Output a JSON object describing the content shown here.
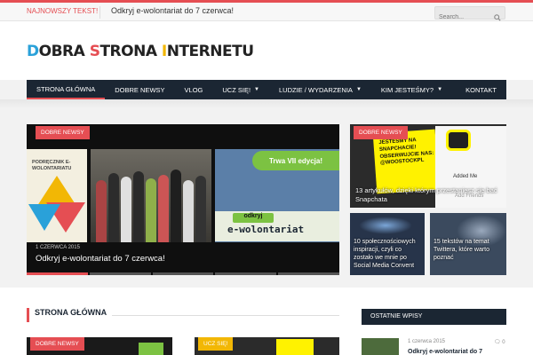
{
  "topbar": {
    "hot_label": "NAJNOWSZY TEKST!",
    "ticker": "Odkryj e-wolontariat do 7 czerwca!",
    "search_placeholder": "Search..."
  },
  "logo": {
    "p1": "D",
    "p2": "OBRA ",
    "p3": "S",
    "p4": "TRONA ",
    "p5": "I",
    "p6": "NTERNETU"
  },
  "nav": [
    {
      "label": "STRONA GŁÓWNA",
      "active": true,
      "dropdown": false
    },
    {
      "label": "DOBRE NEWSY",
      "active": false,
      "dropdown": false
    },
    {
      "label": "VLOG",
      "active": false,
      "dropdown": false
    },
    {
      "label": "UCZ SIĘ!",
      "active": false,
      "dropdown": true
    },
    {
      "label": "LUDZIE / WYDARZENIA",
      "active": false,
      "dropdown": true
    },
    {
      "label": "KIM JESTEŚMY?",
      "active": false,
      "dropdown": true
    },
    {
      "label": "KONTAKT",
      "active": false,
      "dropdown": false
    }
  ],
  "featured": {
    "main": {
      "tag": "DOBRE NEWSY",
      "date": "1 CZERWCA 2015",
      "title": "Odkryj e-wolontariat do 7 czerwca!",
      "poster_text": "PODRĘCZNIK E-WOLONTARIATU",
      "banner_text": "Trwa VII edycja!",
      "ew_line1": "odkryj",
      "ew_line2": "e-wolontariat"
    },
    "side1": {
      "tag": "DOBRE NEWSY",
      "title": "13 artykułów, dzięki którym przestaniesz się bać Snapchata",
      "sign_text": "JESTEŚMY NA SNAPCHACIE! OBSERWUJCIE NAS: @WOOSTOCKPL",
      "added_me": "Added Me",
      "add_friends": "Add Friends"
    },
    "side2": {
      "title": "10 społecznościowych inspiracji, czyli co zostało we mnie po Social Media Convent"
    },
    "side3": {
      "title": "15 tekstów na temat Twittera, które warto poznać"
    }
  },
  "section": {
    "title": "STRONA GŁÓWNA"
  },
  "cards": [
    {
      "tag": "DOBRE NEWSY"
    },
    {
      "tag": "UCZ SIĘ!"
    }
  ],
  "sidebar": {
    "title": "OSTATNIE WPISY",
    "post_date": "1 czerwca 2015",
    "post_comments": "0",
    "post_title": "Odkryj e-wolontariat do 7"
  },
  "colors": {
    "accent": "#e54e53",
    "nav_bg": "#1b2633",
    "yellow": "#f2b705",
    "blue": "#2aa1d9"
  }
}
